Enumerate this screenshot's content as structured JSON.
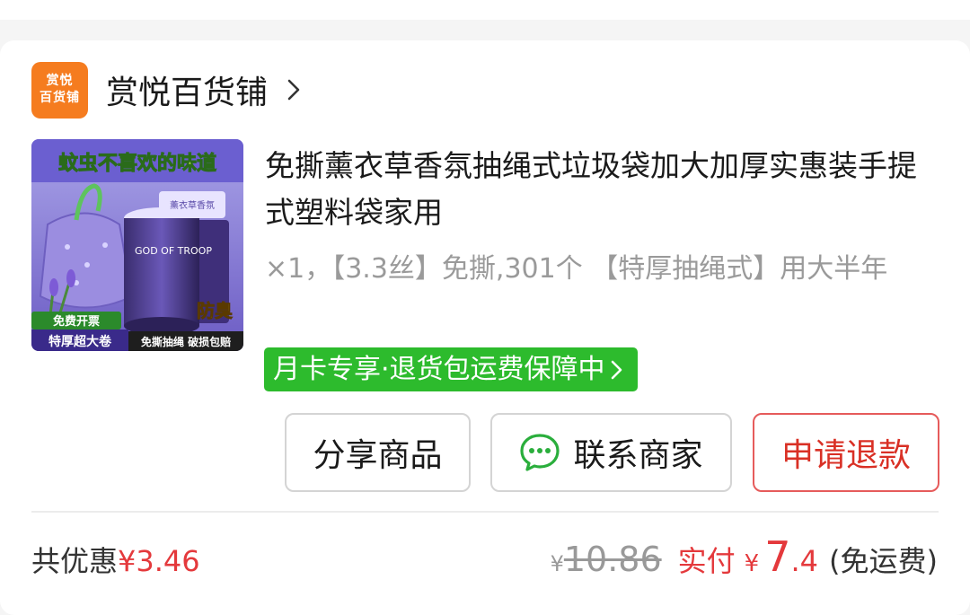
{
  "shop": {
    "logo_line1": "赏悦",
    "logo_line2": "百货铺",
    "name": "赏悦百货铺"
  },
  "product": {
    "image_text": {
      "top_banner": "蚊虫不喜欢的味道",
      "can_label": "薰衣草香氛",
      "can_side": "GOD OF TROOP",
      "badge_odor": "防臭",
      "badge_invoice": "免费开票",
      "badge_thick": "特厚超大卷",
      "footer": "免撕抽绳 破损包赔"
    },
    "title": "免撕薰衣草香氛抽绳式垃圾袋加大加厚实惠装手提式塑料袋家用",
    "spec": "×1，【3.3丝】免撕,301个 【特厚抽绳式】用大半年",
    "promo": "月卡专享·退货包运费保障中"
  },
  "actions": {
    "share": "分享商品",
    "contact": "联系商家",
    "refund": "申请退款"
  },
  "summary": {
    "discount_label": "共优惠",
    "discount_amount": "¥3.46",
    "currency": "¥",
    "original_price": "10.86",
    "paid_label": "实付",
    "paid_int": "7",
    "paid_dec": ".4",
    "shipping": "(免运费)"
  },
  "colors": {
    "accent_red": "#e4393c",
    "promo_green": "#2dbb2d",
    "shop_logo": "#f57c1f",
    "wechat_green": "#2aae3c"
  }
}
